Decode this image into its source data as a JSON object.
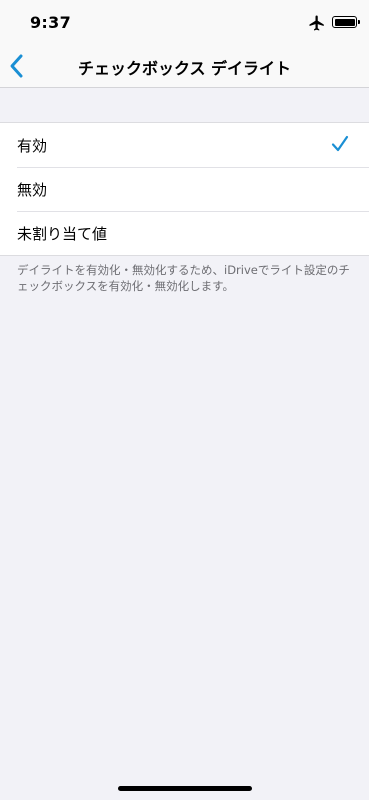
{
  "status_bar": {
    "time": "9:37"
  },
  "nav": {
    "title": "チェックボックス デイライト"
  },
  "options": [
    {
      "label": "有効",
      "selected": true
    },
    {
      "label": "無効",
      "selected": false
    },
    {
      "label": "未割り当て値",
      "selected": false
    }
  ],
  "footer": {
    "note": "デイライトを有効化・無効化するため、iDriveでライト設定のチェックボックスを有効化・無効化します。"
  },
  "colors": {
    "accent": "#1a8fd4",
    "background": "#f2f2f7"
  }
}
